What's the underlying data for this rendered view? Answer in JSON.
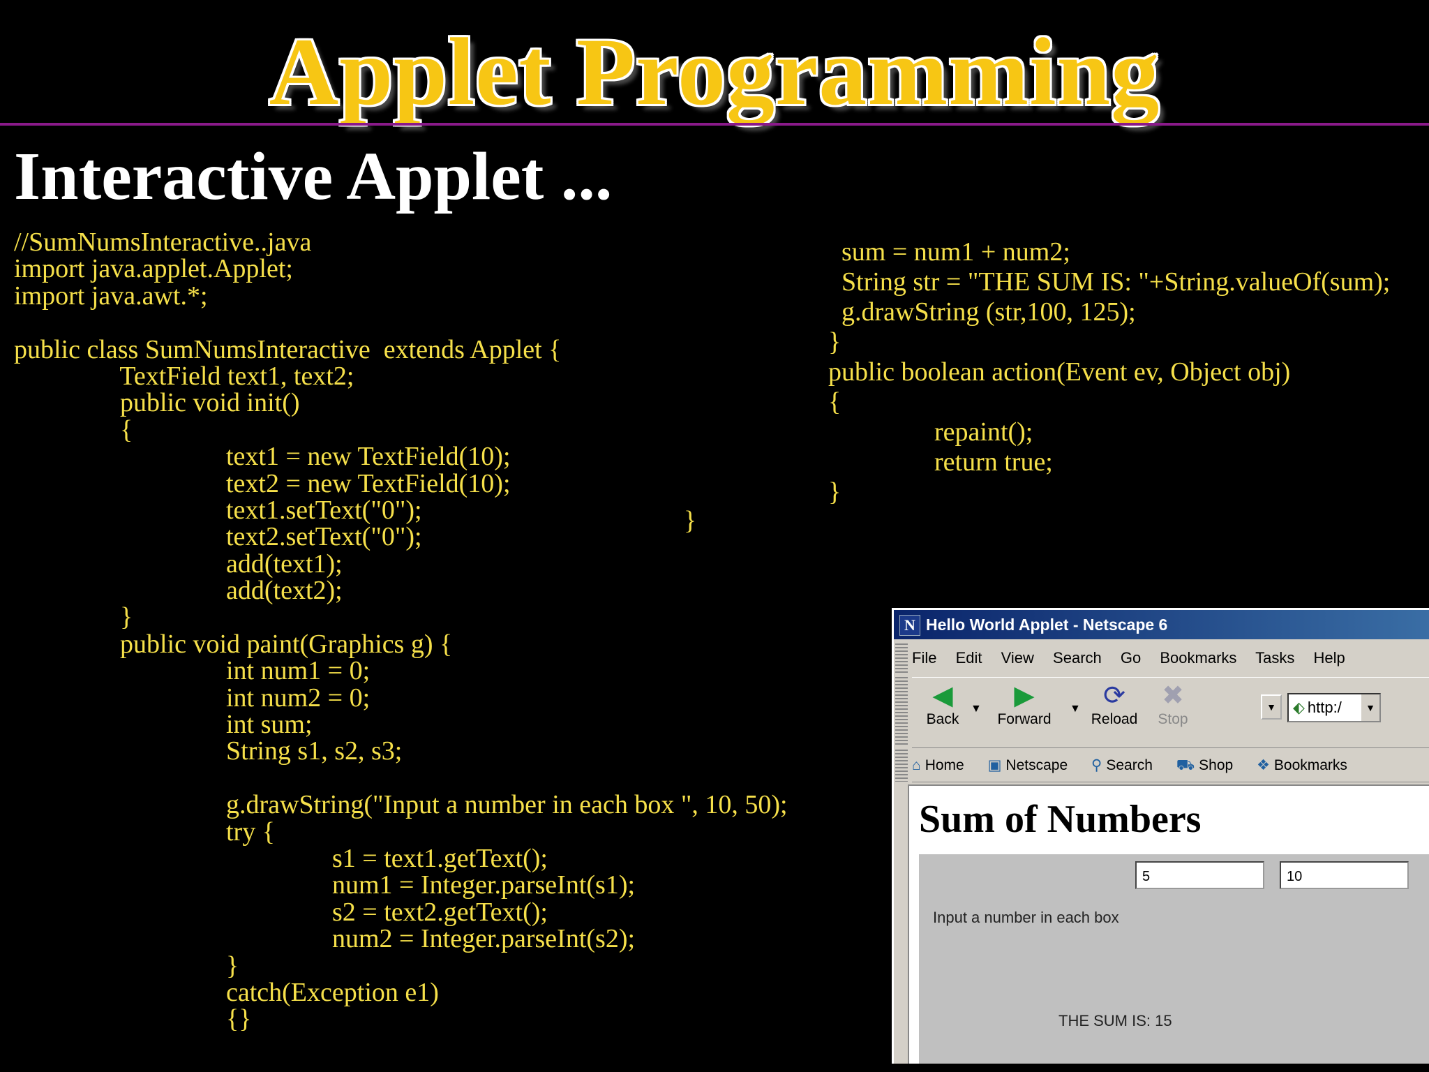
{
  "slide": {
    "title": "Applet Programming",
    "subtitle": "Interactive Applet ..."
  },
  "code_left": [
    "//SumNumsInteractive..java",
    "import java.applet.Applet;",
    "import java.awt.*;",
    "",
    "public class SumNumsInteractive  extends Applet {",
    "                TextField text1, text2;",
    "                public void init()",
    "                {",
    "                                text1 = new TextField(10);",
    "                                text2 = new TextField(10);",
    "                                text1.setText(\"0\");",
    "                                text2.setText(\"0\");",
    "                                add(text1);",
    "                                add(text2);",
    "                }",
    "                public void paint(Graphics g) {",
    "                                int num1 = 0;",
    "                                int num2 = 0;",
    "                                int sum;",
    "                                String s1, s2, s3;",
    "",
    "                                g.drawString(\"Input a number in each box \", 10, 50);",
    "                                try {",
    "                                                s1 = text1.getText();",
    "                                                num1 = Integer.parseInt(s1);",
    "                                                s2 = text2.getText();",
    "                                                num2 = Integer.parseInt(s2);",
    "                                }",
    "                                catch(Exception e1)",
    "                                {}"
  ],
  "code_right": [
    "  sum = num1 + num2;",
    "  String str = \"THE SUM IS: \"+String.valueOf(sum);",
    "  g.drawString (str,100, 125);",
    "}",
    "public boolean action(Event ev, Object obj)",
    "{",
    "                repaint();",
    "                return true;",
    "}"
  ],
  "stray_brace": "}",
  "browser": {
    "window_title": "Hello World Applet - Netscape 6",
    "menu": [
      "File",
      "Edit",
      "View",
      "Search",
      "Go",
      "Bookmarks",
      "Tasks",
      "Help"
    ],
    "nav": {
      "back": "Back",
      "forward": "Forward",
      "reload": "Reload",
      "stop": "Stop",
      "url": "http:/"
    },
    "personal_bar": {
      "home": "Home",
      "netscape": "Netscape",
      "search": "Search",
      "shop": "Shop",
      "bookmarks": "Bookmarks"
    },
    "page": {
      "heading": "Sum of Numbers",
      "field1": "5",
      "field2": "10",
      "prompt": "Input a number in each box",
      "result": "THE SUM IS: 15"
    }
  }
}
